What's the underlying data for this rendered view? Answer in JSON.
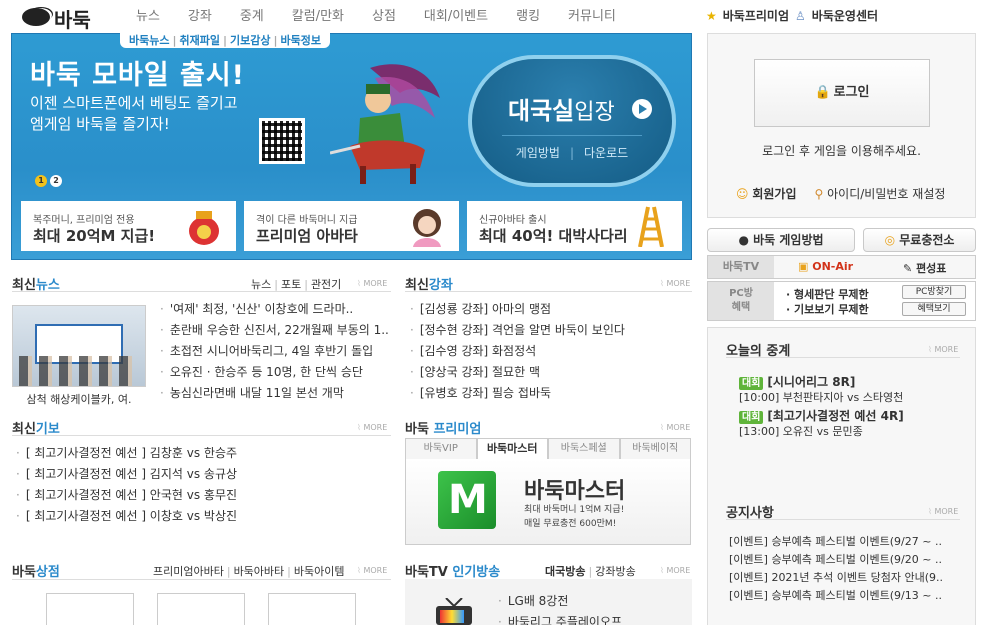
{
  "logo": {
    "text": "바둑"
  },
  "nav": [
    "뉴스",
    "강좌",
    "중계",
    "칼럼/만화",
    "상점",
    "대회/이벤트",
    "랭킹",
    "커뮤니티"
  ],
  "toplinks": {
    "premium": "바둑프리미엄",
    "center": "바둑운영센터"
  },
  "banner": {
    "tabs": [
      "바둑뉴스",
      "취재파일",
      "기보감상",
      "바둑정보"
    ],
    "title": "바둑 모바일 출시!",
    "sub1": "이젠 스마트폰에서 베팅도 즐기고",
    "sub2": "엠게임 바둑을 즐기자!",
    "pages": [
      "1",
      "2"
    ],
    "enter_main": "대국실",
    "enter_suffix": "입장",
    "enter_how": "게임방법",
    "enter_download": "다운로드",
    "promos": [
      {
        "small": "복주머니, 프리미엄 전용",
        "big": "최대 20억M 지급!"
      },
      {
        "small": "격이 다른 바둑머니 지급",
        "big": "프리미엄 아바타"
      },
      {
        "small": "신규아바타 출시",
        "big": "최대 40억! 대박사다리"
      }
    ]
  },
  "news": {
    "title_a": "최신",
    "title_b": "뉴스",
    "links": [
      "뉴스",
      "포토",
      "관전기"
    ],
    "more": "MORE",
    "caption": "삼척 해상케이블카, 여.",
    "items": [
      "'여제' 최정, '신산' 이창호에 드라마..",
      "춘란배 우승한 신진서, 22개월째 부동의 1..",
      "초접전 시니어바둑리그, 4일 후반기 돌입",
      "오유진 · 한승주 등 10명, 한 단씩 승단",
      "농심신라면배 내달 11일 본선 개막"
    ]
  },
  "lecture": {
    "title_a": "최신",
    "title_b": "강좌",
    "more": "MORE",
    "items": [
      "[김성룡 강좌] 아마의 맹점",
      "[정수현 강좌] 격언을 알면 바둑이 보인다",
      "[김수영 강좌] 화점정석",
      "[양상국 강좌] 절묘한 맥",
      "[유병호 강좌] 필승 접바둑"
    ]
  },
  "kibo": {
    "title_a": "최신",
    "title_b": "기보",
    "more": "MORE",
    "items": [
      "[ 최고기사결정전 예선 ] 김창훈 vs 한승주",
      "[ 최고기사결정전 예선 ] 김지석 vs 송규상",
      "[ 최고기사결정전 예선 ] 안국현 vs 홍무진",
      "[ 최고기사결정전 예선 ] 이창호 vs 박상진"
    ]
  },
  "premium": {
    "title_a": "바둑 ",
    "title_b": "프리미엄",
    "more": "MORE",
    "tabs": [
      "바둑VIP",
      "바둑마스터",
      "바둑스페셜",
      "바둑베이직"
    ],
    "product": "바둑마스터",
    "desc1": "최대 바둑머니 1억M 지급!",
    "desc2": "매일 무료충전 600만M!",
    "logo_letter": "M"
  },
  "shop": {
    "title_a": "바둑",
    "title_b": "상점",
    "more": "MORE",
    "links": [
      "프리미엄아바타",
      "바둑아바타",
      "바둑아이템"
    ]
  },
  "tv": {
    "title_a": "바둑TV ",
    "title_b": "인기방송",
    "more": "MORE",
    "links": [
      "대국방송",
      "강좌방송"
    ],
    "items": [
      "LG배 8강전",
      "바둑리그 주플레이오프"
    ]
  },
  "login": {
    "button": "로그인",
    "message": "로그인 후 게임을 이용해주세요.",
    "join": "회원가입",
    "find": "아이디/비밀번호 재설정"
  },
  "quick": {
    "howto": "바둑 게임방법",
    "charge": "무료충전소"
  },
  "tvbar": {
    "label": "바둑TV",
    "onair": "ON-Air",
    "schedule": "편성표"
  },
  "pcbar": {
    "label1": "PC방",
    "label2": "혜택",
    "item1": "· 형세판단 무제한",
    "item2": "· 기보보기 무제한",
    "btn1": "PC방찾기",
    "btn2": "혜택보기"
  },
  "relay": {
    "title": "오늘의 중계",
    "more": "MORE",
    "items": [
      {
        "tag": "대회",
        "title": "[시니어리그 8R]",
        "sub": "[10:00] 부천판타지아 vs 스타영천"
      },
      {
        "tag": "대회",
        "title": "[최고기사결정전 예선 4R]",
        "sub": "[13:00] 오유진 vs 문민종"
      }
    ]
  },
  "notice": {
    "title": "공지사항",
    "more": "MORE",
    "items": [
      "[이벤트] 승부예측 페스티벌 이벤트(9/27 ~ ..",
      "[이벤트] 승부예측 페스티벌 이벤트(9/20 ~ ..",
      "[이벤트] 2021년 추석 이벤트 당첨자 안내(9..",
      "[이벤트] 승부예측 페스티벌 이벤트(9/13 ~ .."
    ]
  },
  "colors": {
    "accent": "#2b8acb",
    "banner": "#2e9bd3",
    "onair": "#d2331a",
    "tag": "#5fb43a"
  }
}
